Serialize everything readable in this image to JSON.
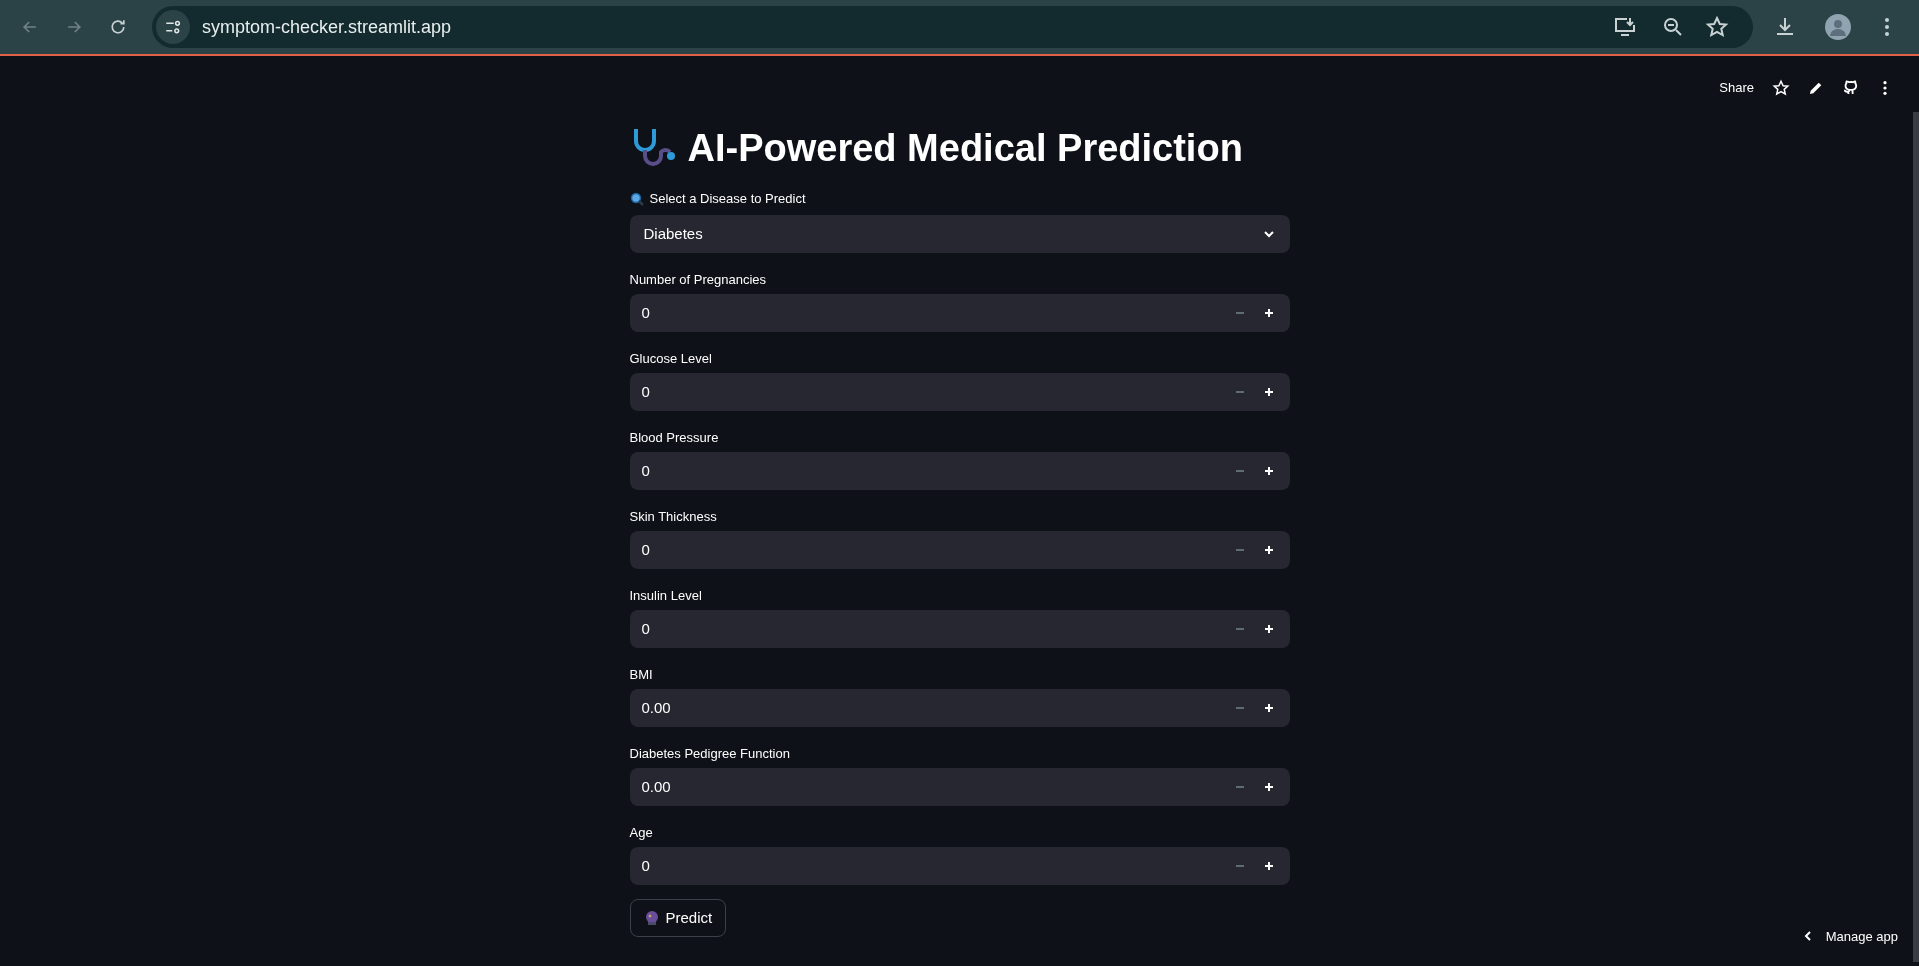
{
  "browser": {
    "url": "symptom-checker.streamlit.app"
  },
  "toolbar": {
    "share": "Share"
  },
  "title": "AI-Powered Medical Prediction",
  "select": {
    "label": "Select a Disease to Predict",
    "value": "Diabetes"
  },
  "fields": [
    {
      "label": "Number of Pregnancies",
      "value": "0",
      "decrement_disabled": true
    },
    {
      "label": "Glucose Level",
      "value": "0",
      "decrement_disabled": true
    },
    {
      "label": "Blood Pressure",
      "value": "0",
      "decrement_disabled": true
    },
    {
      "label": "Skin Thickness",
      "value": "0",
      "decrement_disabled": true
    },
    {
      "label": "Insulin Level",
      "value": "0",
      "decrement_disabled": true
    },
    {
      "label": "BMI",
      "value": "0.00",
      "decrement_disabled": true
    },
    {
      "label": "Diabetes Pedigree Function",
      "value": "0.00",
      "decrement_disabled": true
    },
    {
      "label": "Age",
      "value": "0",
      "decrement_disabled": true
    }
  ],
  "predict_button": "Predict",
  "manage_app": "Manage app"
}
